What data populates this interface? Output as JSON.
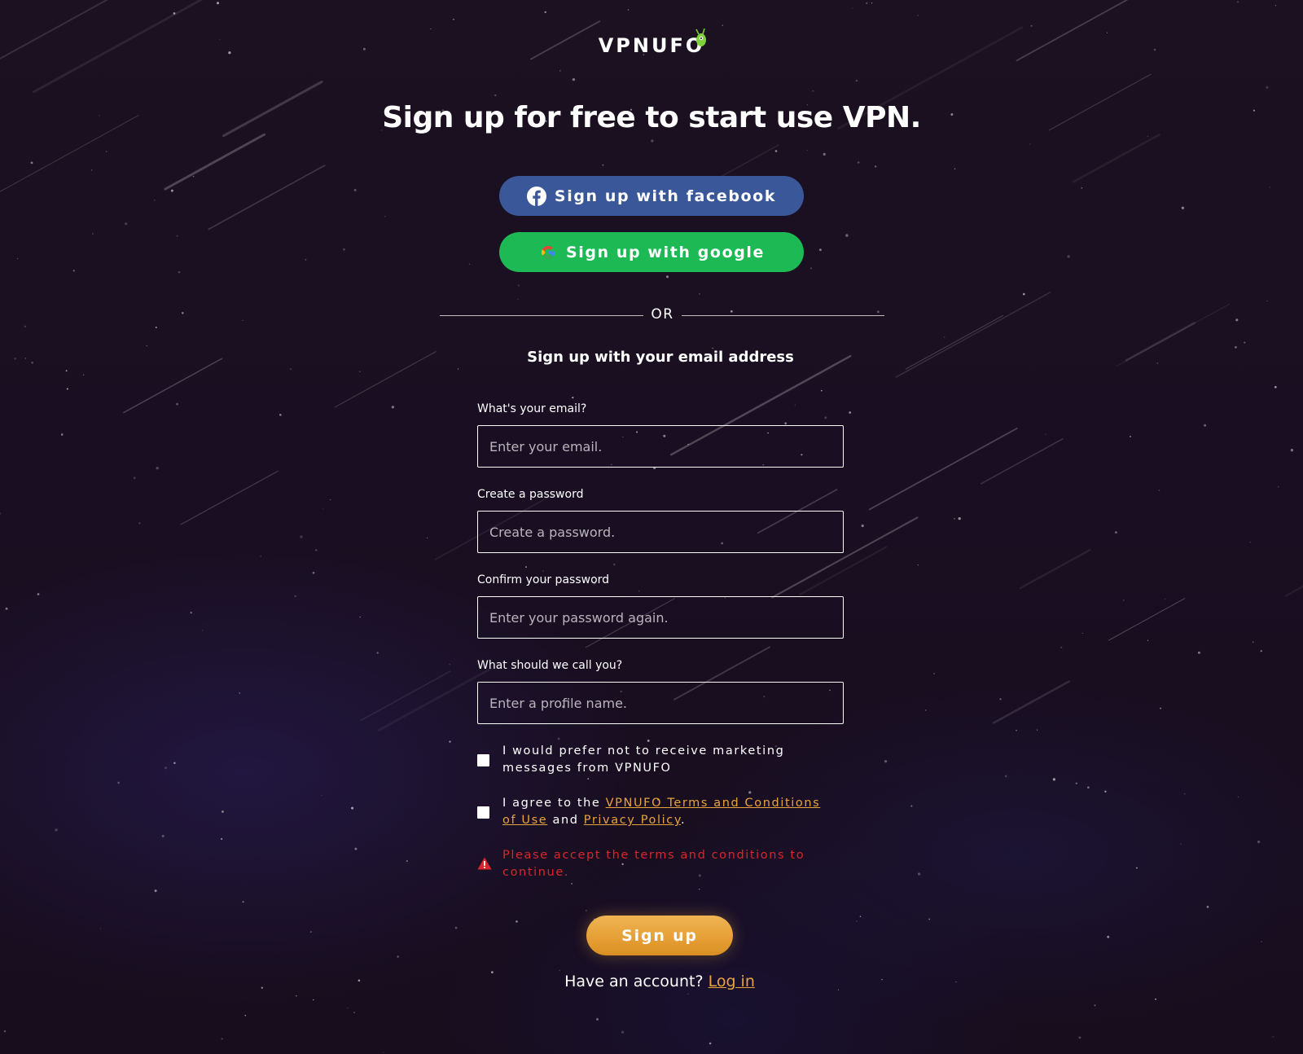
{
  "brand": {
    "name": "VPNUFO",
    "accent_color": "#e8a33c",
    "error_color": "#d9262b",
    "facebook_color": "#3a579a",
    "google_color": "#1db954"
  },
  "headline": "Sign up for free to start use VPN.",
  "social": {
    "facebook_label": "Sign up with facebook",
    "facebook_icon": "facebook-icon",
    "google_label": "Sign up with google",
    "google_icon": "google-icon"
  },
  "divider": {
    "label": "OR"
  },
  "email_section": {
    "heading": "Sign up with your email address"
  },
  "form": {
    "email": {
      "label": "What's your email?",
      "placeholder": "Enter your email.",
      "value": ""
    },
    "password": {
      "label": "Create a password",
      "placeholder": "Create a password.",
      "value": ""
    },
    "confirm_password": {
      "label": "Confirm your password",
      "placeholder": "Enter your password again.",
      "value": ""
    },
    "profile_name": {
      "label": "What should we call you?",
      "placeholder": "Enter a profile name.",
      "value": ""
    }
  },
  "checkboxes": {
    "marketing": {
      "label": "I would prefer not to receive marketing messages from VPNUFO",
      "checked": false
    },
    "terms": {
      "prefix": "I agree to the ",
      "terms_link": "VPNUFO Terms and Conditions of Use",
      "middle": " and ",
      "privacy_link": "Privacy Policy",
      "suffix": ".",
      "checked": false
    }
  },
  "error": {
    "icon": "warning-icon",
    "message": "Please accept the terms and conditions to continue."
  },
  "submit": {
    "label": "Sign up"
  },
  "login": {
    "prompt": "Have an account? ",
    "link": "Log in"
  }
}
